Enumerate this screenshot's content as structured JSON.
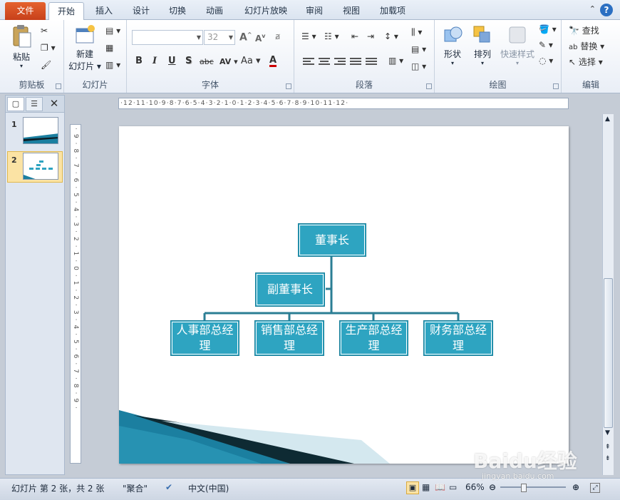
{
  "tabs": [
    "文件",
    "开始",
    "插入",
    "设计",
    "切换",
    "动画",
    "幻灯片放映",
    "审阅",
    "视图",
    "加载项"
  ],
  "ribbon": {
    "clipboard": {
      "group": "剪贴板",
      "paste": "粘贴"
    },
    "slides": {
      "group": "幻灯片",
      "new_slide_l1": "新建",
      "new_slide_l2": "幻灯片"
    },
    "font": {
      "group": "字体",
      "font_size": "32",
      "bold": "B",
      "italic": "I",
      "underline": "U",
      "shadow": "S",
      "strike": "abc",
      "spacing": "AV",
      "case": "Aa",
      "color": "A",
      "grow": "A",
      "shrink": "A"
    },
    "paragraph": {
      "group": "段落"
    },
    "drawing": {
      "group": "绘图",
      "shapes": "形状",
      "arrange": "排列",
      "quick_styles": "快速样式"
    },
    "editing": {
      "group": "编辑",
      "find": "查找",
      "replace": "替换",
      "select": "选择"
    }
  },
  "slides_panel": {
    "items": [
      {
        "num": "1"
      },
      {
        "num": "2"
      }
    ]
  },
  "ruler_h": "·12·11·10·9·8·7·6·5·4·3·2·1·0·1·2·3·4·5·6·7·8·9·10·11·12·",
  "ruler_v": "·9·8·7·6·5·4·3·2·1·0·1·2·3·4·5·6·7·8·9·",
  "org_chart": {
    "top": "董事长",
    "assistant": "副董事长",
    "subs_line1": [
      "人事部总经",
      "销售部总经",
      "生产部总经",
      "财务部总经"
    ],
    "subs_line2": "理"
  },
  "status": {
    "slide_info": "幻灯片 第 2 张，共 2 张",
    "theme": "\"聚合\"",
    "lang": "中文(中国)",
    "zoom": "66%"
  },
  "watermark": {
    "logo": "Baidu经验",
    "url": "jingyan.baidu.com"
  },
  "colors": {
    "accent": "#2ea4c1",
    "file_tab": "#d4512a"
  }
}
